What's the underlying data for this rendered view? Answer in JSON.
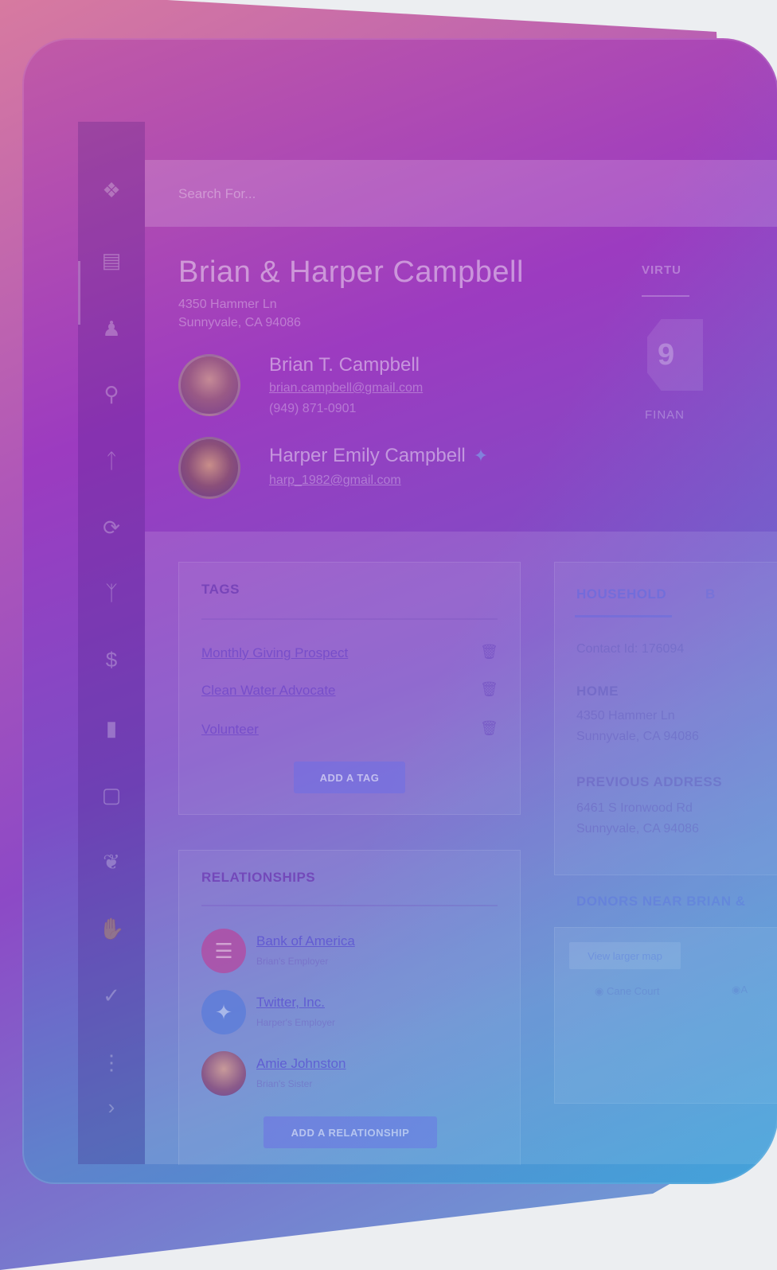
{
  "search": {
    "placeholder": "Search For..."
  },
  "header": {
    "title": "Brian & Harper Campbell",
    "address_line1": "4350 Hammer Ln",
    "address_line2": "Sunnyvale, CA 94086"
  },
  "people": [
    {
      "name": "Brian T. Campbell",
      "email": "brian.campbell@gmail.com",
      "phone": "(949) 871-0901"
    },
    {
      "name": "Harper Emily Campbell",
      "email": "harp_1982@gmail.com"
    }
  ],
  "score": {
    "tab_label": "VIRTU",
    "value": "9",
    "label": "FINAN"
  },
  "tags": {
    "title": "TAGS",
    "items": [
      "Monthly Giving Prospect",
      "Clean Water Advocate",
      "Volunteer"
    ],
    "add_label": "ADD A TAG"
  },
  "relationships": {
    "title": "RELATIONSHIPS",
    "items": [
      {
        "name": "Bank of America",
        "role": "Brian's Employer"
      },
      {
        "name": "Twitter, Inc.",
        "role": "Harper's Employer"
      },
      {
        "name": "Amie Johnston",
        "role": "Brian's Sister"
      }
    ],
    "add_label": "ADD A RELATIONSHIP"
  },
  "household": {
    "tabs": [
      "HOUSEHOLD",
      "B"
    ],
    "contact_id": "Contact Id: 176094",
    "home_label": "HOME",
    "home_line1": "4350 Hammer Ln",
    "home_line2": "Sunnyvale, CA 94086",
    "prev_label": "PREVIOUS ADDRESS",
    "prev_line1": "6461 S Ironwood Rd",
    "prev_line2": "Sunnyvale, CA 94086"
  },
  "donors": {
    "title": "DONORS NEAR BRIAN &",
    "map_button": "View larger map",
    "places": [
      "Cane Court",
      "A"
    ]
  },
  "colors": {
    "gradient_start": "#c15aa6",
    "gradient_mid": "#8d49c6",
    "gradient_end": "#3d9ad4"
  }
}
